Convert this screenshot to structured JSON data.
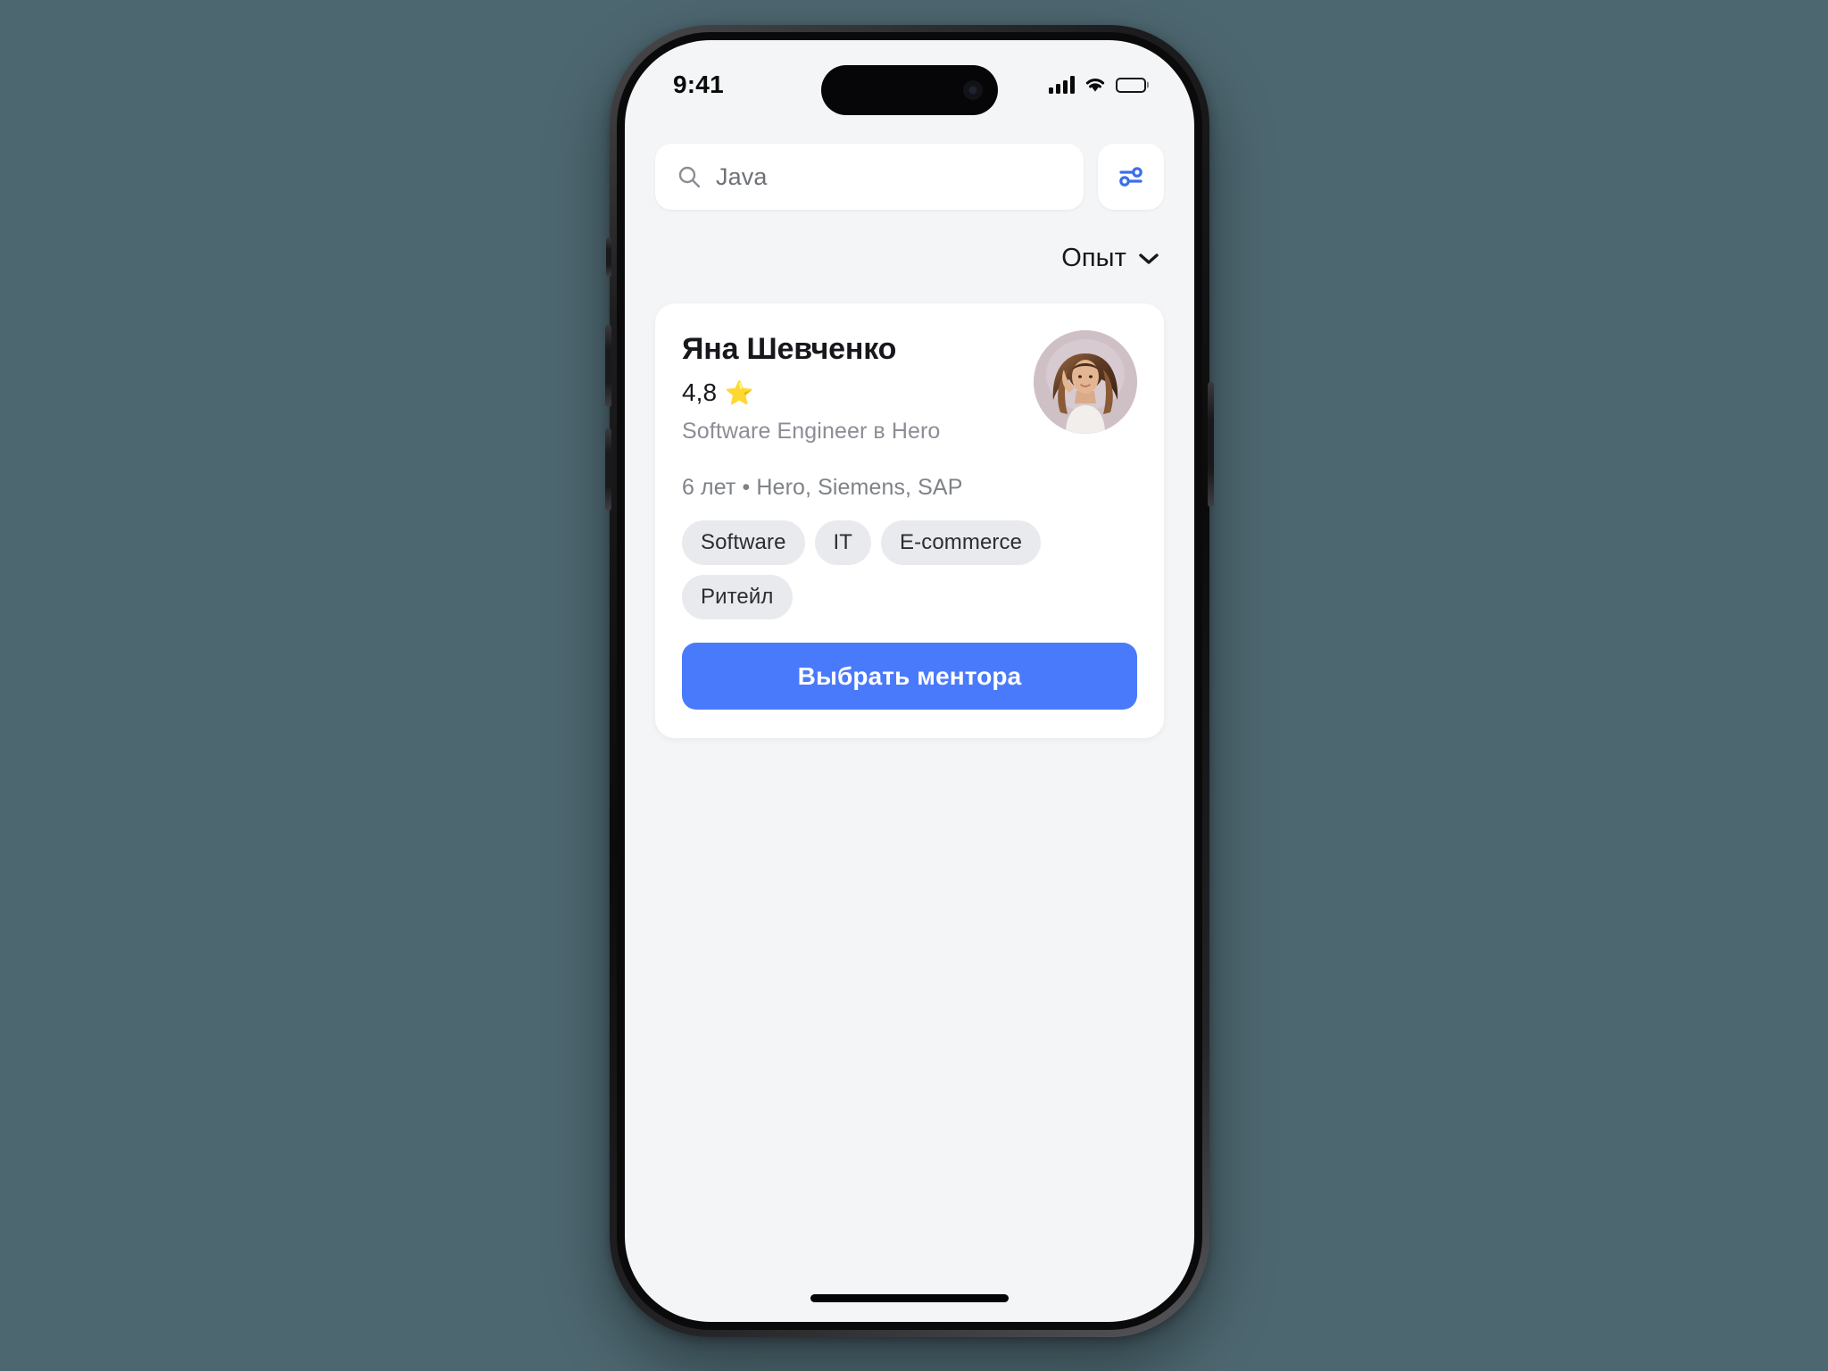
{
  "device": {
    "status_bar": {
      "time": "9:41",
      "cellular_icon": "cellular-bars-icon",
      "wifi_icon": "wifi-icon",
      "battery_icon": "battery-full-icon"
    },
    "home_indicator": "home-indicator"
  },
  "search": {
    "icon": "search-icon",
    "value": "Java",
    "placeholder": "Java"
  },
  "filter": {
    "icon": "sliders-filter-icon",
    "accent_color": "#3b6fe8"
  },
  "sort": {
    "label": "Опыт",
    "chevron_icon": "chevron-down-icon"
  },
  "mentor_card": {
    "name": "Яна Шевченко",
    "rating": "4,8",
    "rating_star_icon": "star-icon",
    "role": "Software Engineer в Hero",
    "experience": "6 лет • Hero, Siemens, SAP",
    "avatar_alt": "avatar",
    "tags": [
      "Software",
      "IT",
      "E-commerce",
      "Ритейл"
    ],
    "cta_label": "Выбрать ментора",
    "cta_color": "#4a7afc"
  },
  "theme": {
    "page_background": "#4d6770",
    "screen_background": "#f4f5f7",
    "card_background": "#ffffff",
    "tag_background": "#e9eaed",
    "text_primary": "#17181c",
    "text_secondary": "#8b8e94"
  }
}
